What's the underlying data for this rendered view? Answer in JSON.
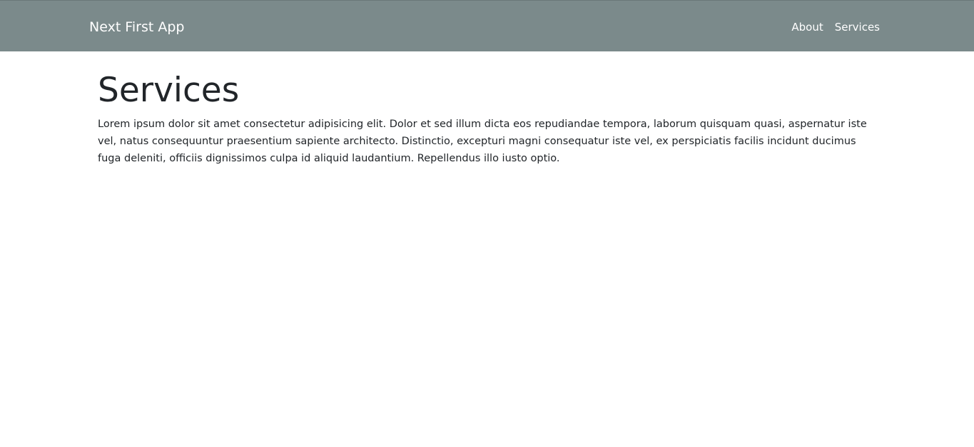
{
  "navbar": {
    "brand": "Next First App",
    "links": [
      {
        "label": "About"
      },
      {
        "label": "Services"
      }
    ]
  },
  "main": {
    "title": "Services",
    "body": "Lorem ipsum dolor sit amet consectetur adipisicing elit. Dolor et sed illum dicta eos repudiandae tempora, laborum quisquam quasi, aspernatur iste vel, natus consequuntur praesentium sapiente architecto. Distinctio, excepturi magni consequatur iste vel, ex perspiciatis facilis incidunt ducimus fuga deleniti, officiis dignissimos culpa id aliquid laudantium. Repellendus illo iusto optio."
  },
  "colors": {
    "navbar_bg": "#7b8a8b",
    "navbar_text": "#ffffff",
    "body_text": "#212529"
  }
}
